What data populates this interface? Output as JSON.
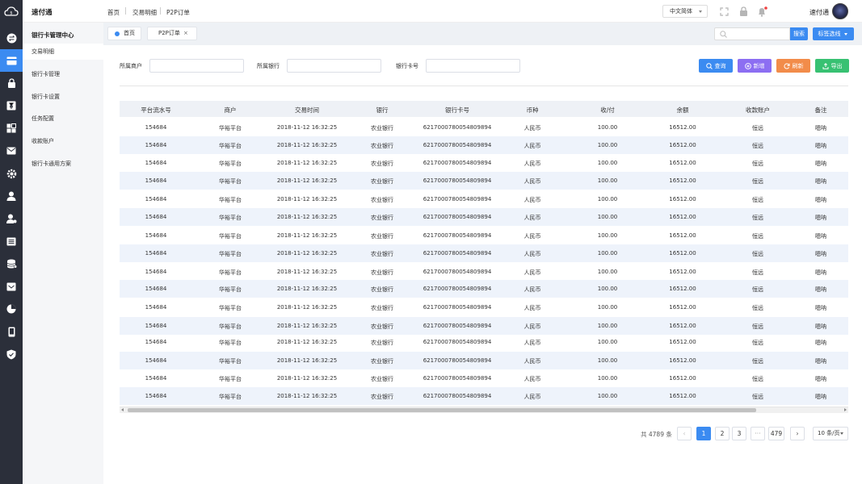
{
  "app": {
    "title": "速付通"
  },
  "breadcrumb": [
    "首页",
    "交易明细",
    "P2P订单"
  ],
  "header": {
    "language": "中文简体",
    "user_name": "速付通"
  },
  "menu": {
    "title": "银行卡管理中心",
    "items": [
      "交易明细",
      "银行卡管理",
      "银行卡设置",
      "任务配置",
      "收款账户",
      "银行卡通用方案"
    ]
  },
  "tabs": [
    {
      "label": "首页"
    },
    {
      "label": "P2P订单",
      "close": "×"
    }
  ],
  "search": {
    "button": "搜索",
    "tag_options": "标签选线"
  },
  "filters": [
    {
      "label": "所属商户",
      "value": ""
    },
    {
      "label": "所属银行",
      "value": ""
    },
    {
      "label": "银行卡号",
      "value": ""
    }
  ],
  "actions": {
    "query": "查询",
    "add": "新增",
    "refresh": "刷新",
    "export": "导出"
  },
  "colors": {
    "primary": "#3b8bf1",
    "add": "#8c6ef2",
    "refresh": "#f28c4a",
    "export": "#38c172",
    "sidebar": "#2b2f3a"
  },
  "table": {
    "columns": [
      "平台流水号",
      "商户",
      "交易时间",
      "银行",
      "银行卡号",
      "币种",
      "收/付",
      "余额",
      "收款账户",
      "备注"
    ],
    "rows": [
      [
        "154684",
        "华裕平台",
        "2018-11-12 16:32:25",
        "农业银行",
        "6217000780054809894",
        "人民币",
        "100.00",
        "16512.00",
        "恒远",
        "嗯呐"
      ],
      [
        "154684",
        "华裕平台",
        "2018-11-12 16:32:25",
        "农业银行",
        "6217000780054809894",
        "人民币",
        "100.00",
        "16512.00",
        "恒远",
        "嗯呐"
      ],
      [
        "154684",
        "华裕平台",
        "2018-11-12 16:32:25",
        "农业银行",
        "6217000780054809894",
        "人民币",
        "100.00",
        "16512.00",
        "恒远",
        "嗯呐"
      ],
      [
        "154684",
        "华裕平台",
        "2018-11-12 16:32:25",
        "农业银行",
        "6217000780054809894",
        "人民币",
        "100.00",
        "16512.00",
        "恒远",
        "嗯呐"
      ],
      [
        "154684",
        "华裕平台",
        "2018-11-12 16:32:25",
        "农业银行",
        "6217000780054809894",
        "人民币",
        "100.00",
        "16512.00",
        "恒远",
        "嗯呐"
      ],
      [
        "154684",
        "华裕平台",
        "2018-11-12 16:32:25",
        "农业银行",
        "6217000780054809894",
        "人民币",
        "100.00",
        "16512.00",
        "恒远",
        "嗯呐"
      ],
      [
        "154684",
        "华裕平台",
        "2018-11-12 16:32:25",
        "农业银行",
        "6217000780054809894",
        "人民币",
        "100.00",
        "16512.00",
        "恒远",
        "嗯呐"
      ],
      [
        "154684",
        "华裕平台",
        "2018-11-12 16:32:25",
        "农业银行",
        "6217000780054809894",
        "人民币",
        "100.00",
        "16512.00",
        "恒远",
        "嗯呐"
      ],
      [
        "154684",
        "华裕平台",
        "2018-11-12 16:32:25",
        "农业银行",
        "6217000780054809894",
        "人民币",
        "100.00",
        "16512.00",
        "恒远",
        "嗯呐"
      ],
      [
        "154684",
        "华裕平台",
        "2018-11-12 16:32:25",
        "农业银行",
        "6217000780054809894",
        "人民币",
        "100.00",
        "16512.00",
        "恒远",
        "嗯呐"
      ],
      [
        "154684",
        "华裕平台",
        "2018-11-12 16:32:25",
        "农业银行",
        "6217000780054809894",
        "人民币",
        "100.00",
        "16512.00",
        "恒远",
        "嗯呐"
      ],
      [
        "154684",
        "华裕平台",
        "2018-11-12 16:32:25",
        "农业银行",
        "6217000780054809894",
        "人民币",
        "100.00",
        "16512.00",
        "恒远",
        "嗯呐"
      ],
      [
        "154684",
        "华裕平台",
        "2018-11-12 16:32:25",
        "农业银行",
        "6217000780054809894",
        "人民币",
        "100.00",
        "16512.00",
        "恒远",
        "嗯呐"
      ],
      [
        "154684",
        "华裕平台",
        "2018-11-12 16:32:25",
        "农业银行",
        "6217000780054809894",
        "人民币",
        "100.00",
        "16512.00",
        "恒远",
        "嗯呐"
      ],
      [
        "154684",
        "华裕平台",
        "2018-11-12 16:32:25",
        "农业银行",
        "6217000780054809894",
        "人民币",
        "100.00",
        "16512.00",
        "恒远",
        "嗯呐"
      ],
      [
        "154684",
        "华裕平台",
        "2018-11-12 16:32:25",
        "农业银行",
        "6217000780054809894",
        "人民币",
        "100.00",
        "16512.00",
        "恒远",
        "嗯呐"
      ]
    ]
  },
  "pagination": {
    "total": "共 4789 条",
    "pages": [
      "1",
      "2",
      "3",
      "···",
      "479"
    ],
    "current": "1",
    "page_size": "10 条/页"
  }
}
